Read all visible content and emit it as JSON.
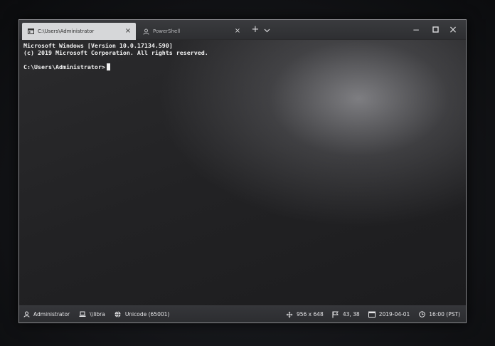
{
  "tabs": [
    {
      "label": "C:\\Users\\Administrator",
      "icon": "cmd-icon",
      "active": true
    },
    {
      "label": "PowerShell",
      "icon": "user-icon",
      "active": false
    }
  ],
  "tab_controls": {
    "close": "×",
    "new_tab": "+",
    "dropdown": "⌄"
  },
  "window_controls": {
    "minimize": "−",
    "maximize": "□",
    "close": "×"
  },
  "terminal": {
    "lines": [
      "Microsoft Windows [Version 10.0.17134.590]",
      "(c) 2019 Microsoft Corporation. All rights reserved.",
      "",
      "C:\\Users\\Administrator>"
    ]
  },
  "status": {
    "user": "Administrator",
    "host": "\\\\libra",
    "encoding": "Unicode (65001)",
    "size": "956 x 648",
    "cursor_pos": "43, 38",
    "date": "2019-04-01",
    "time": "16:00 (PST)"
  },
  "colors": {
    "active_tab": "#d6d7d9",
    "titlebar": "#333437",
    "terminal_text": "#f2f2f2",
    "statusbar": "#303134"
  }
}
